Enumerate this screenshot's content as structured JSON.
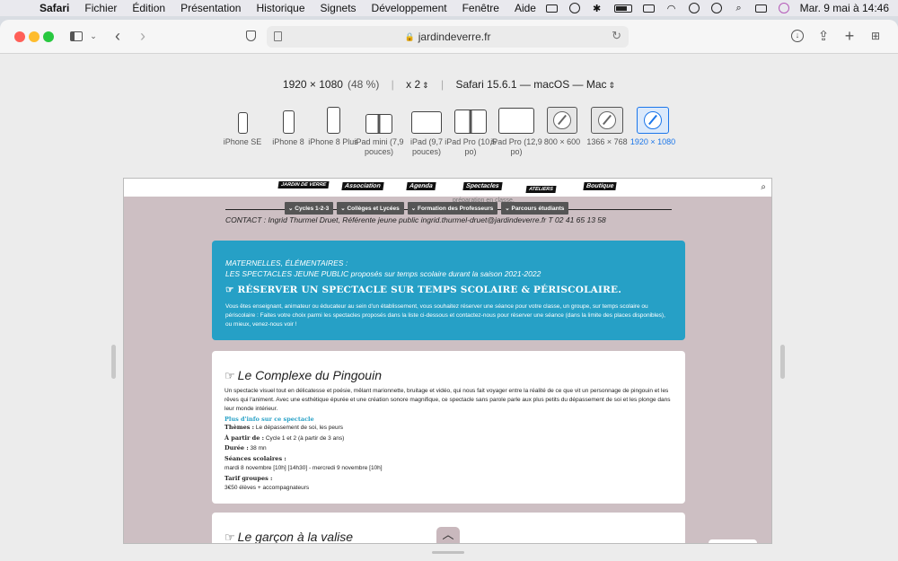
{
  "menubar": {
    "app": "Safari",
    "items": [
      "Fichier",
      "Édition",
      "Présentation",
      "Historique",
      "Signets",
      "Développement",
      "Fenêtre",
      "Aide"
    ],
    "datetime": "Mar. 9 mai à 14:46"
  },
  "browser": {
    "url": "jardindeverre.fr"
  },
  "responsive": {
    "resolution": "1920 × 1080",
    "scale": "(48 %)",
    "pixel_ratio": "x 2",
    "user_agent": "Safari 15.6.1 — macOS — Mac",
    "devices": [
      {
        "label": "iPhone SE",
        "icon": "iphone-se-icon"
      },
      {
        "label": "iPhone 8",
        "icon": "iphone-8-icon"
      },
      {
        "label": "iPhone 8 Plus",
        "icon": "iphone-8-plus-icon"
      },
      {
        "label": "iPad mini (7,9 pouces)",
        "icon": "ipad-mini-icon"
      },
      {
        "label": "iPad (9,7 pouces)",
        "icon": "ipad-icon"
      },
      {
        "label": "iPad Pro (10,5 po)",
        "icon": "ipad-pro-10-icon"
      },
      {
        "label": "iPad Pro (12,9 po)",
        "icon": "ipad-pro-12-icon"
      },
      {
        "label": "800 × 600",
        "icon": "desktop-icon"
      },
      {
        "label": "1366 × 768",
        "icon": "desktop-icon"
      },
      {
        "label": "1920 × 1080",
        "icon": "desktop-icon",
        "selected": true
      }
    ]
  },
  "site": {
    "nav": [
      "JARDIN DE VERRE",
      "Association",
      "Agenda",
      "Spectacles",
      "ATELIERS",
      "Boutique"
    ],
    "ghost_text": "préparation en classe.",
    "subnav": [
      "Cycles 1-2-3",
      "Collèges et Lycées",
      "Formation des Professeurs",
      "Parcours étudiants"
    ],
    "contact": "CONTACT : Ingrid Thurmel Druet, Référente jeune public ingrid.thurmel-druet@jardindeverre.fr T 02 41 65 13 58",
    "hero": {
      "line1": "MATERNELLES, ÉLÉMENTAIRES :",
      "line2": "LES SPECTACLES JEUNE PUBLIC proposés sur temps scolaire durant la saison 2021-2022",
      "title": "☞ RÉSERVER UN SPECTACLE SUR TEMPS SCOLAIRE & PÉRISCOLAIRE.",
      "body": "Vous êtes enseignant, animateur ou éducateur au sein d'un établissement, vous souhaitez réserver une séance pour votre classe, un groupe, sur temps scolaire ou périscolaire : Faites votre choix parmi les spectacles proposés dans la liste ci-dessous et contactez-nous pour réserver une séance (dans la limite des places disponibles), ou mieux, venez-nous voir !"
    },
    "show1": {
      "title": "Le Complexe du Pingouin",
      "description": "Un spectacle visuel tout en délicatesse et poésie, mêlant marionnette, bruitage et vidéo, qui nous fait voyager entre la réalité de ce que vit un personnage de pingouin et les rêves qui l'animent. Avec une esthétique épurée et une création sonore magnifique, ce spectacle sans parole parle aux plus petits du dépassement de soi et les plonge dans leur monde intérieur.",
      "more": "Plus d'info sur ce spectacle",
      "themes_label": "Thèmes :",
      "themes": "Le dépassement de soi, les peurs",
      "age_label": "À partir de :",
      "age": "Cycle 1 et 2 (à partir de 3 ans)",
      "duration_label": "Durée :",
      "duration": "38 mn",
      "sessions_label": "Séances scolaires :",
      "sessions": "mardi 8 novembre [10h] [14h30] - mercredi 9 novembre [10h]",
      "price_label": "Tarif groupes :",
      "price": "3€50 élèves + accompagnateurs"
    },
    "show2": {
      "title": "Le garçon à la valise"
    }
  }
}
